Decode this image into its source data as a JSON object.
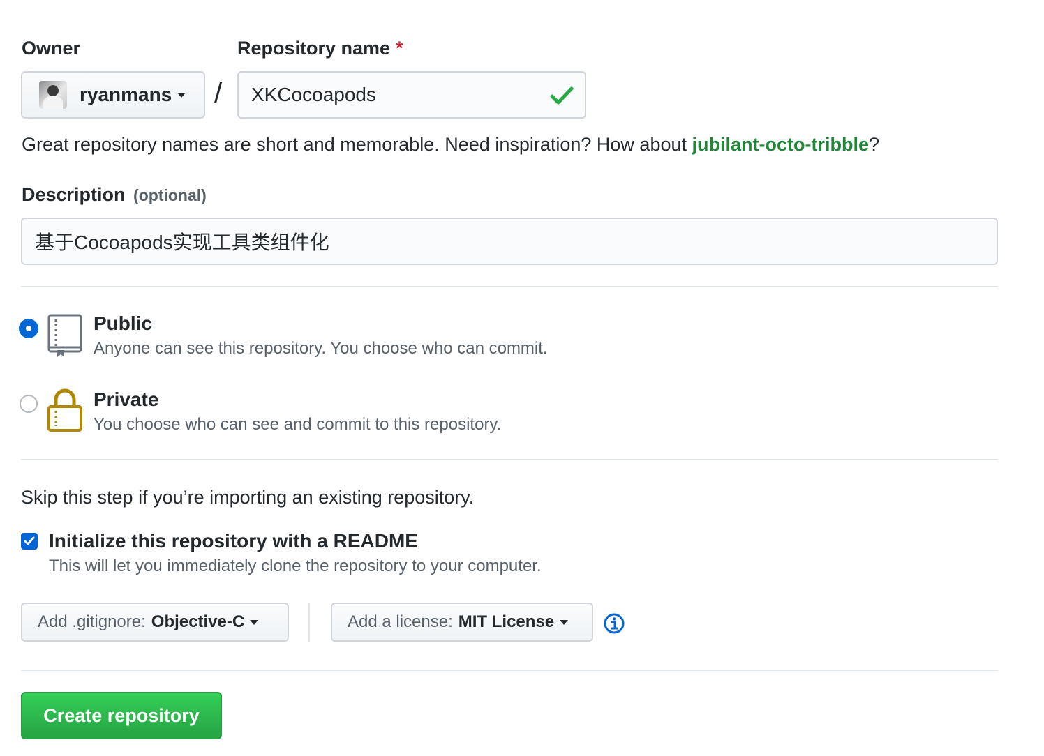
{
  "owner": {
    "label": "Owner",
    "selected": "ryanmans"
  },
  "repo_name": {
    "label": "Repository name",
    "required_mark": "*",
    "separator": "/",
    "value": "XKCocoapods"
  },
  "hint": {
    "text": "Great repository names are short and memorable. Need inspiration? How about ",
    "suggestion": "jubilant-octo-tribble",
    "suffix": "?"
  },
  "description": {
    "label": "Description",
    "optional": "(optional)",
    "value": "基于Cocoapods实现工具类组件化"
  },
  "visibility": {
    "public": {
      "title": "Public",
      "desc": "Anyone can see this repository. You choose who can commit.",
      "checked": true
    },
    "private": {
      "title": "Private",
      "desc": "You choose who can see and commit to this repository.",
      "checked": false
    }
  },
  "init": {
    "skip_text": "Skip this step if you’re importing an existing repository.",
    "readme_label": "Initialize this repository with a README",
    "readme_desc": "This will let you immediately clone the repository to your computer.",
    "readme_checked": true
  },
  "gitignore": {
    "prefix": "Add .gitignore:",
    "value": "Objective-C"
  },
  "license": {
    "prefix": "Add a license:",
    "value": "MIT License"
  },
  "submit": {
    "label": "Create repository"
  },
  "colors": {
    "accent": "#0366d6",
    "success": "#28a745",
    "link_green": "#22863a"
  }
}
